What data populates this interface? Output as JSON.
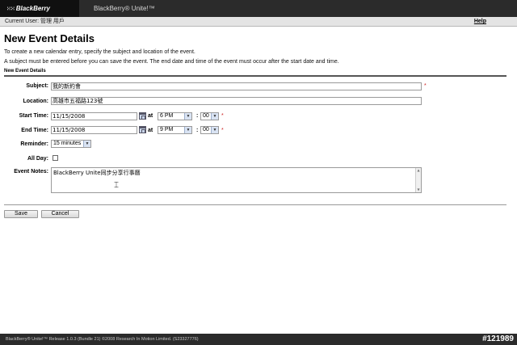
{
  "header": {
    "logo_text": "BlackBerry",
    "logo_mark": "⁙⁙",
    "app_title": "BlackBerry® Unite!™"
  },
  "userbar": {
    "current_user": "Current User: 管理 用戶",
    "help": "Help"
  },
  "page": {
    "title": "New Event Details",
    "instruction_1": "To create a new calendar entry, specify the subject and location of the event.",
    "instruction_2": "A subject must be entered before you can save the event. The end date and time of the event must occur after the start date and time.",
    "section_title": "New Event Details"
  },
  "form": {
    "subject_label": "Subject:",
    "subject_value": "我的新約會",
    "location_label": "Location:",
    "location_value": "高雄市五福路123號",
    "start_label": "Start Time:",
    "start_date": "11/15/2008",
    "start_hour": "6 PM",
    "start_minute": "00",
    "end_label": "End Time:",
    "end_date": "11/15/2008",
    "end_hour": "9 PM",
    "end_minute": "00",
    "at": "at",
    "colon": ":",
    "required_mark": "*",
    "reminder_label": "Reminder:",
    "reminder_value": "15 minutes",
    "allday_label": "All Day:",
    "notes_label": "Event Notes:",
    "notes_value": "BlackBerry Unite同步分享行事曆"
  },
  "buttons": {
    "save": "Save",
    "cancel": "Cancel"
  },
  "footer": {
    "text": "BlackBerry® Unite!™ Release 1.0.3 (Bundle 21)  ©2008 Research In Motion Limited. (S23327776)",
    "watermark": "#121989"
  },
  "icons": {
    "dropdown": "▼",
    "calendar": "calendar-icon"
  },
  "colors": {
    "topbar": "#2b2b2b",
    "required": "#cc2222"
  }
}
